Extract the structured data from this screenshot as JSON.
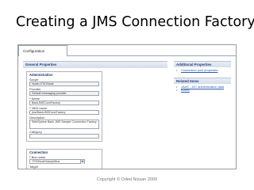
{
  "slide": {
    "title": "Creating a JMS Connection Factory.",
    "caption": "Copyright © Oded Nissan 2009"
  },
  "tab": {
    "label": "Configuration"
  },
  "general_properties": {
    "header": "General Properties",
    "administration": {
      "title": "Administration",
      "scope_label": "Scope",
      "scope_value": "Node=ITSONode",
      "provider_label": "Provider",
      "provider_value": "Default messaging provider",
      "name_label": "Name",
      "name_value": "BankJMSConnFactory",
      "jndi_label": "JNDI name",
      "jndi_value": "jms/BankJMSConnFactory",
      "description_label": "Description",
      "description_value": "WebSphere Bank JMS Sample Connection Factory",
      "category_label": "Category",
      "category_value": ""
    },
    "connection": {
      "title": "Connection",
      "bus_label": "Bus name",
      "bus_value": "ITSONodeSampleBus",
      "target_label": "Target",
      "target_value": ""
    }
  },
  "additional_properties": {
    "header": "Additional Properties",
    "items": [
      "Connection pool properties"
    ]
  },
  "related_items": {
    "header": "Related Items",
    "items": [
      "JAAS - J2C authentication data",
      "Buses"
    ]
  },
  "colors": {
    "header_text": "#26427a",
    "link": "#2a5bb5",
    "required": "#cc0000"
  }
}
